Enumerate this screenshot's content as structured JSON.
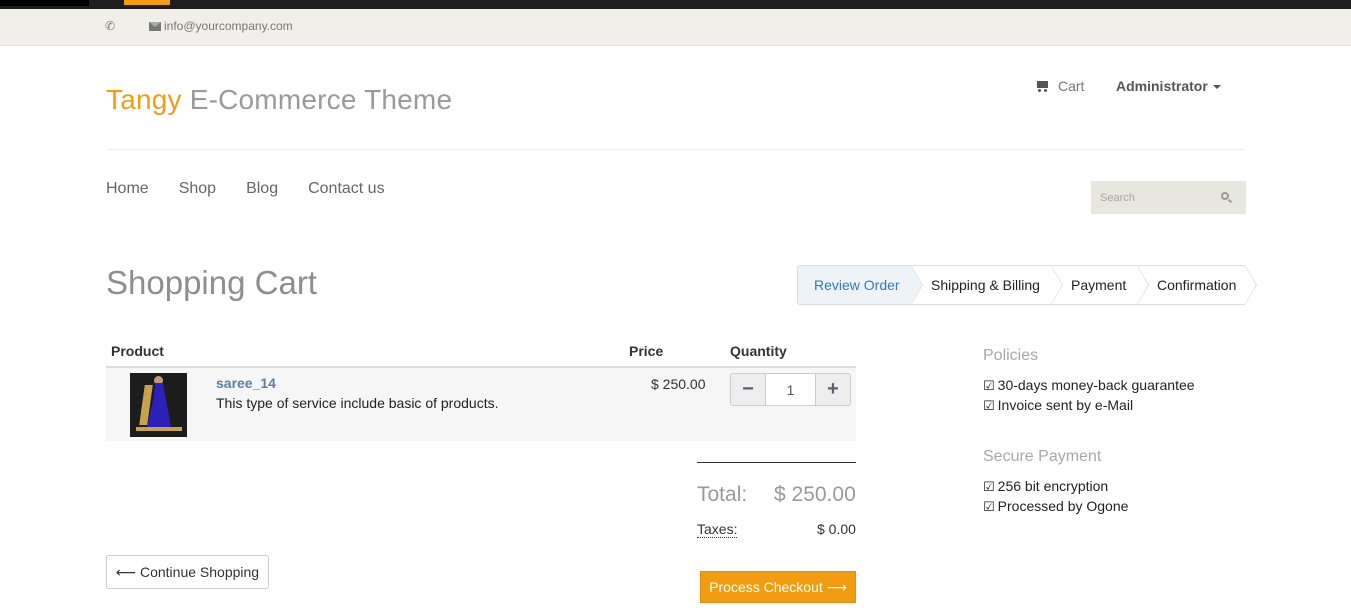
{
  "colors": {
    "accent": "#f39c12",
    "link": "#5b7fa6",
    "active_step": "#337ab7"
  },
  "topbar": {
    "phone_icon": "phone-icon",
    "email_icon": "envelope-icon",
    "email": "info@yourcompany.com"
  },
  "header": {
    "brand_part1": "Tangy",
    "brand_part2": "E-Commerce Theme",
    "cart_label": "Cart",
    "user_label": "Administrator"
  },
  "nav": {
    "items": [
      {
        "label": "Home"
      },
      {
        "label": "Shop"
      },
      {
        "label": "Blog"
      },
      {
        "label": "Contact us"
      }
    ]
  },
  "search": {
    "placeholder": "Search"
  },
  "page": {
    "title": "Shopping Cart"
  },
  "wizard": {
    "steps": [
      {
        "label": "Review Order",
        "active": true
      },
      {
        "label": "Shipping & Billing"
      },
      {
        "label": "Payment"
      },
      {
        "label": "Confirmation"
      }
    ]
  },
  "cart": {
    "columns": {
      "product": "Product",
      "price": "Price",
      "quantity": "Quantity"
    },
    "items": [
      {
        "name": "saree_14",
        "description": "This type of service include basic of products.",
        "price": "$ 250.00",
        "quantity": "1"
      }
    ],
    "minus": "−",
    "plus": "+",
    "total_label": "Total:",
    "total_value": "$ 250.00",
    "taxes_label": "Taxes:",
    "taxes_value": "$ 0.00",
    "continue_label": "Continue Shopping",
    "checkout_label": "Process Checkout"
  },
  "sidebar": {
    "policies_title": "Policies",
    "policies": [
      "30-days money-back guarantee",
      "Invoice sent by e-Mail"
    ],
    "payment_title": "Secure Payment",
    "payment": [
      "256 bit encryption",
      "Processed by Ogone"
    ],
    "check_glyph": "☑"
  }
}
